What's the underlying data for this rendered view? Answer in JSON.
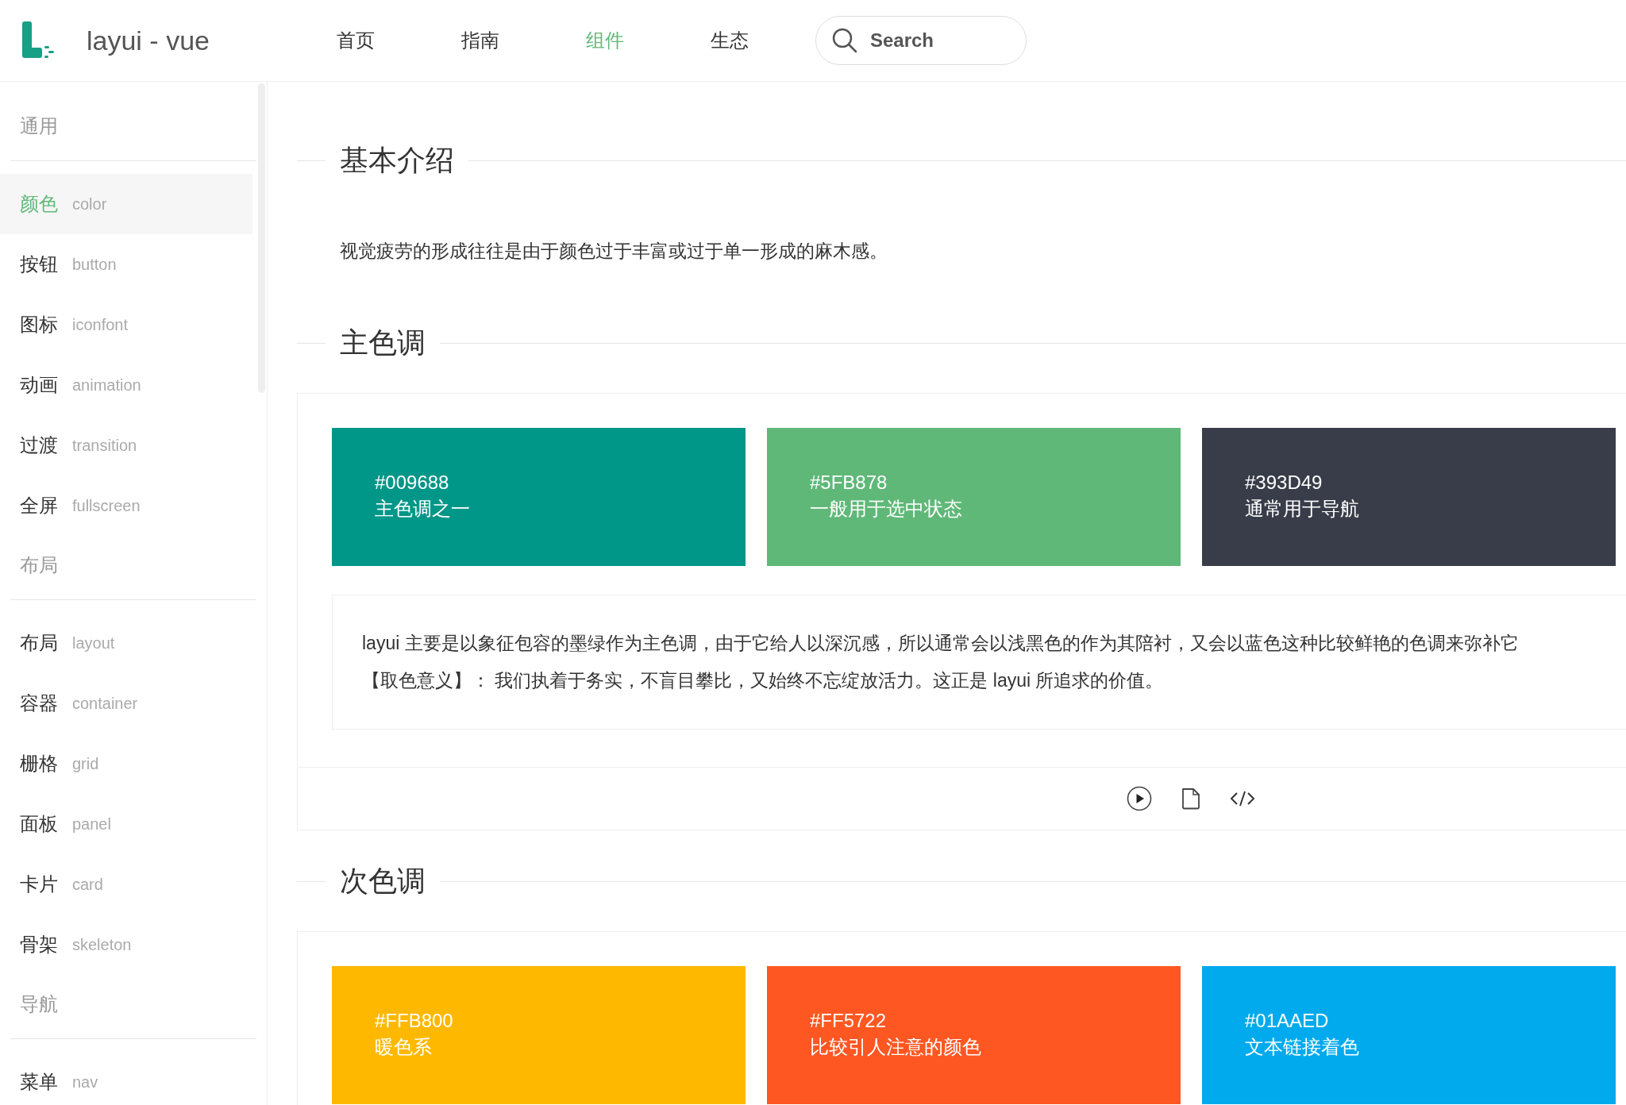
{
  "header": {
    "logo_text": "layui - vue",
    "nav": [
      {
        "label": "首页",
        "selected": false
      },
      {
        "label": "指南",
        "selected": false
      },
      {
        "label": "组件",
        "selected": true
      },
      {
        "label": "生态",
        "selected": false
      }
    ],
    "search": {
      "placeholder": "Search"
    }
  },
  "sidebar": {
    "groups": [
      {
        "title": "通用",
        "items": [
          {
            "label": "颜色",
            "sublabel": "color",
            "selected": true
          },
          {
            "label": "按钮",
            "sublabel": "button",
            "selected": false
          },
          {
            "label": "图标",
            "sublabel": "iconfont",
            "selected": false
          },
          {
            "label": "动画",
            "sublabel": "animation",
            "selected": false
          },
          {
            "label": "过渡",
            "sublabel": "transition",
            "selected": false
          },
          {
            "label": "全屏",
            "sublabel": "fullscreen",
            "selected": false
          }
        ]
      },
      {
        "title": "布局",
        "items": [
          {
            "label": "布局",
            "sublabel": "layout",
            "selected": false
          },
          {
            "label": "容器",
            "sublabel": "container",
            "selected": false
          },
          {
            "label": "栅格",
            "sublabel": "grid",
            "selected": false
          },
          {
            "label": "面板",
            "sublabel": "panel",
            "selected": false
          },
          {
            "label": "卡片",
            "sublabel": "card",
            "selected": false
          },
          {
            "label": "骨架",
            "sublabel": "skeleton",
            "selected": false
          }
        ]
      },
      {
        "title": "导航",
        "items": [
          {
            "label": "菜单",
            "sublabel": "nav",
            "selected": false
          }
        ]
      }
    ]
  },
  "content": {
    "sections": [
      {
        "heading": "基本介绍",
        "kind": "text",
        "text": "视觉疲劳的形成往往是由于颜色过于丰富或过于单一形成的麻木感。"
      },
      {
        "heading": "主色调",
        "kind": "demo",
        "swatches": [
          {
            "code": "#009688",
            "description": "主色调之一",
            "color": "#009688"
          },
          {
            "code": "#5FB878",
            "description": "一般用于选中状态",
            "color": "#5fb878"
          },
          {
            "code": "#393D49",
            "description": "通常用于导航",
            "color": "#393d49"
          }
        ],
        "description_lines": [
          "layui 主要是以象征包容的墨绿作为主色调，由于它给人以深沉感，所以通常会以浅黑色的作为其陪衬，又会以蓝色这种比较鲜艳的色调来弥补它",
          "【取色意义】： 我们执着于务实，不盲目攀比，又始终不忘绽放活力。这正是 layui 所追求的价值。"
        ]
      },
      {
        "heading": "次色调",
        "kind": "demo",
        "swatches": [
          {
            "code": "#FFB800",
            "description": "暖色系",
            "color": "#ffb800"
          },
          {
            "code": "#FF5722",
            "description": "比较引人注意的颜色",
            "color": "#ff5722"
          },
          {
            "code": "#01AAED",
            "description": "文本链接着色",
            "color": "#01aaed"
          }
        ]
      }
    ]
  }
}
